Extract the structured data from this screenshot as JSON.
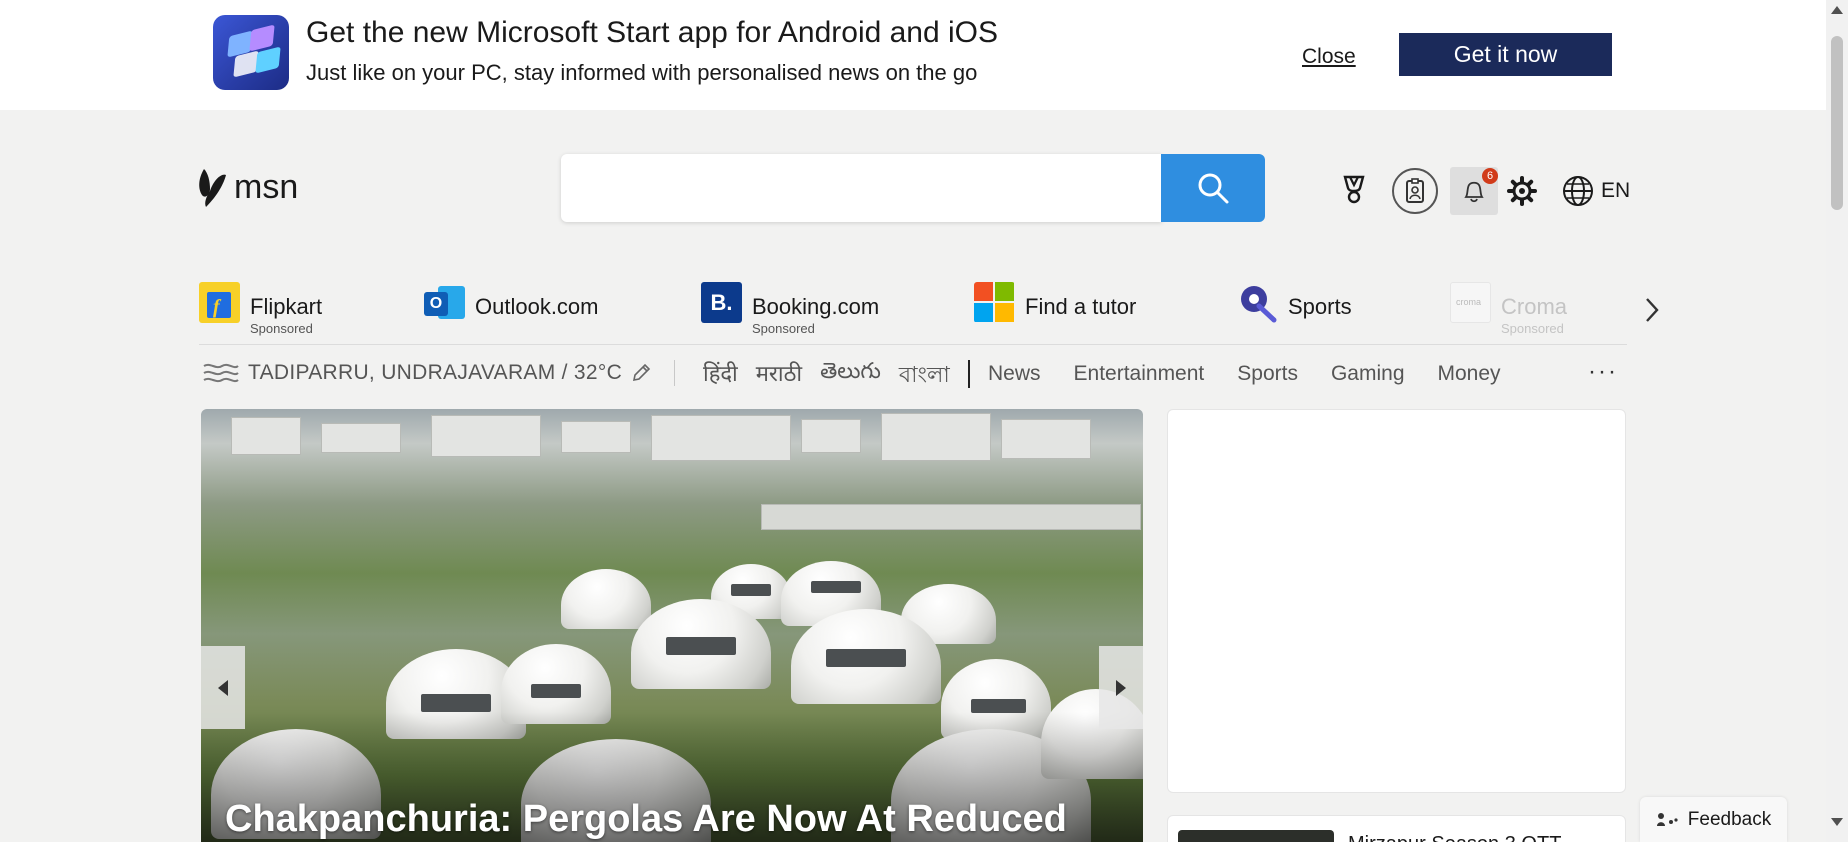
{
  "banner": {
    "title": "Get the new Microsoft Start app for Android and iOS",
    "subtitle": "Just like on your PC, stay informed with personalised news on the go",
    "close_label": "Close",
    "cta_label": "Get it now"
  },
  "header": {
    "logo_text": "msn",
    "search_placeholder": "",
    "notifications_count": "6",
    "language": "EN"
  },
  "quick_links": [
    {
      "name": "Flipkart",
      "sponsored": "Sponsored",
      "icon": "flipkart-icon"
    },
    {
      "name": "Outlook.com",
      "sponsored": "",
      "icon": "outlook-icon"
    },
    {
      "name": "Booking.com",
      "sponsored": "Sponsored",
      "icon": "booking-icon"
    },
    {
      "name": "Find a tutor",
      "sponsored": "",
      "icon": "tutor-icon"
    },
    {
      "name": "Sports",
      "sponsored": "",
      "icon": "sports-icon"
    },
    {
      "name": "Croma",
      "sponsored": "Sponsored",
      "icon": "croma-icon"
    }
  ],
  "weather": {
    "location": "TADIPARRU, UNDRAJAVARAM / 32°C"
  },
  "languages": [
    "हिंदी",
    "मराठी",
    "తెలుగు",
    "বাংলা"
  ],
  "nav": [
    "News",
    "Entertainment",
    "Sports",
    "Gaming",
    "Money"
  ],
  "more_label": "···",
  "hero": {
    "headline": "Chakpanchuria: Pergolas Are Now At Reduced"
  },
  "side_story": {
    "title": "Mirzapur Season 3 OTT"
  },
  "feedback_label": "Feedback",
  "colors": {
    "brand_blue": "#2f8ee0",
    "cta_navy": "#1b2a5a",
    "badge_red": "#d13b1a",
    "page_bg": "#f2f2f1"
  }
}
